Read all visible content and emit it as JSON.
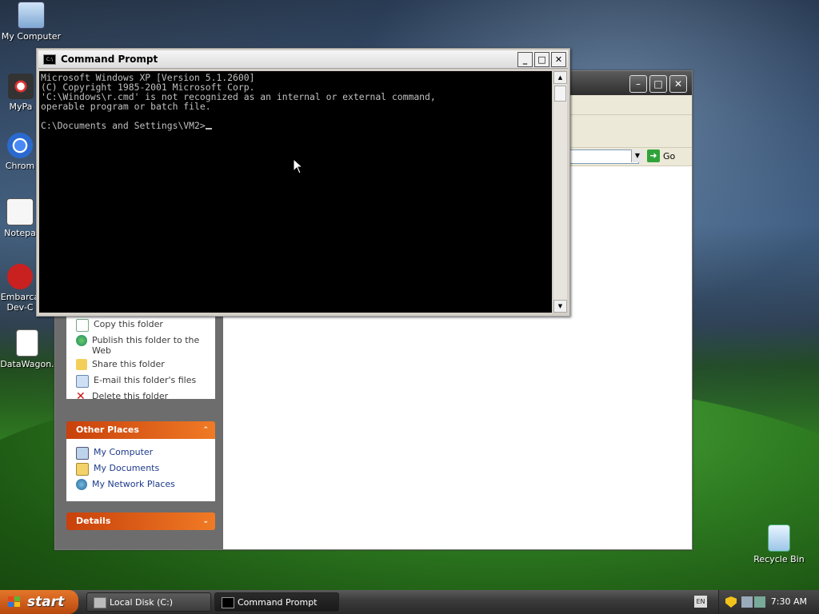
{
  "desktop_icons": [
    {
      "id": "my-computer",
      "label": "My Computer"
    },
    {
      "id": "mypaint",
      "label": "MyPa"
    },
    {
      "id": "chrome",
      "label": "Chrom"
    },
    {
      "id": "notepad",
      "label": "Notepa"
    },
    {
      "id": "embarcadero",
      "label": "Embarca\nDev-C"
    },
    {
      "id": "datawagon",
      "label": "DataWagon."
    },
    {
      "id": "recycle-bin",
      "label": "Recycle Bin"
    }
  ],
  "explorer": {
    "go_label": "Go",
    "file_tasks": [
      "Copy this folder",
      "Publish this folder to the Web",
      "Share this folder",
      "E-mail this folder's files",
      "Delete this folder"
    ],
    "other_places_title": "Other Places",
    "other_places": [
      "My Computer",
      "My Documents",
      "My Network Places"
    ],
    "details_title": "Details"
  },
  "cmd": {
    "title": "Command Prompt",
    "icon_text": "C:\\",
    "lines": [
      "Microsoft Windows XP [Version 5.1.2600]",
      "(C) Copyright 1985-2001 Microsoft Corp.",
      "'C:\\Windows\\r.cmd' is not recognized as an internal or external command,",
      "operable program or batch file.",
      "",
      "C:\\Documents and Settings\\VM2>"
    ]
  },
  "taskbar": {
    "start_label": "start",
    "buttons": [
      "Local Disk (C:)",
      "Command Prompt"
    ],
    "lang": "EN",
    "clock": "7:30 AM"
  }
}
